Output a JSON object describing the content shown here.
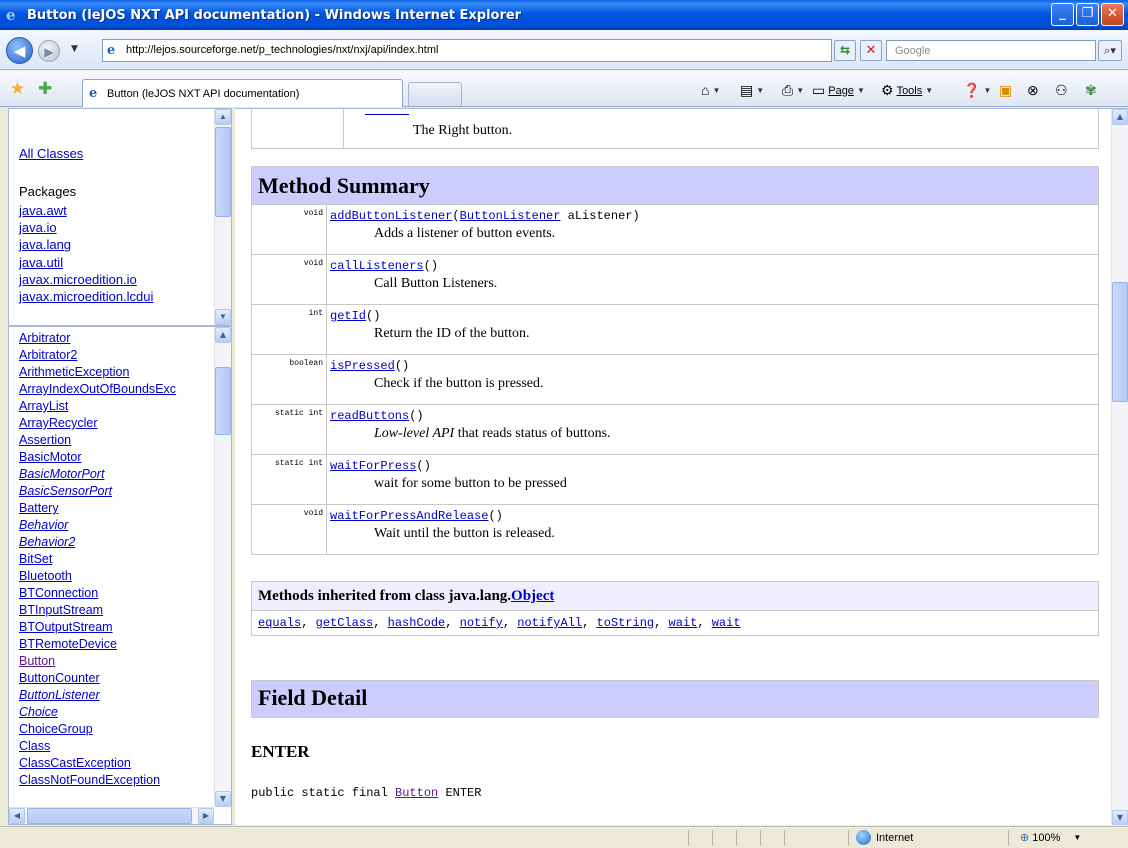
{
  "window": {
    "title": "Button (leJOS NXT API documentation) - Windows Internet Explorer",
    "buttons": [
      "_",
      "❐",
      "✕"
    ]
  },
  "addressbar": {
    "url": "http://lejos.sourceforge.net/p_technologies/nxt/nxj/api/index.html",
    "search_placeholder": "Google"
  },
  "tabbar": {
    "tab_label": "Button (leJOS NXT API documentation)",
    "page_label": "Page",
    "tools_label": "Tools"
  },
  "packages_frame": {
    "all_classes": "All Classes",
    "header": "Packages",
    "items": [
      "java.awt",
      "java.io",
      "java.lang",
      "java.util",
      "javax.microedition.io",
      "javax.microedition.lcdui"
    ]
  },
  "classes_frame": {
    "items": [
      {
        "label": "Arbitrator",
        "italic": false
      },
      {
        "label": "Arbitrator2",
        "italic": false
      },
      {
        "label": "ArithmeticException",
        "italic": false
      },
      {
        "label": "ArrayIndexOutOfBoundsExc",
        "italic": false
      },
      {
        "label": "ArrayList",
        "italic": false
      },
      {
        "label": "ArrayRecycler",
        "italic": false
      },
      {
        "label": "Assertion",
        "italic": false
      },
      {
        "label": "BasicMotor",
        "italic": false
      },
      {
        "label": "BasicMotorPort",
        "italic": true
      },
      {
        "label": "BasicSensorPort",
        "italic": true
      },
      {
        "label": "Battery",
        "italic": false
      },
      {
        "label": "Behavior",
        "italic": true
      },
      {
        "label": "Behavior2",
        "italic": true
      },
      {
        "label": "BitSet",
        "italic": false
      },
      {
        "label": "Bluetooth",
        "italic": false
      },
      {
        "label": "BTConnection",
        "italic": false
      },
      {
        "label": "BTInputStream",
        "italic": false
      },
      {
        "label": "BTOutputStream",
        "italic": false
      },
      {
        "label": "BTRemoteDevice",
        "italic": false
      },
      {
        "label": "Button",
        "italic": false
      },
      {
        "label": "ButtonCounter",
        "italic": false
      },
      {
        "label": "ButtonListener",
        "italic": true
      },
      {
        "label": "Choice",
        "italic": true
      },
      {
        "label": "ChoiceGroup",
        "italic": false
      },
      {
        "label": "Class",
        "italic": false
      },
      {
        "label": "ClassCastException",
        "italic": false
      },
      {
        "label": "ClassNotFoundException",
        "italic": false
      }
    ]
  },
  "content": {
    "top_row_text": "The Right button.",
    "method_summary_title": "Method Summary",
    "methods": [
      {
        "modifier": "void",
        "name": "addButtonListener",
        "params_prefix": "(",
        "param_type": "ButtonListener",
        "params_suffix": " aListener)",
        "desc": "Adds a listener of button events.",
        "desc_em": ""
      },
      {
        "modifier": "void",
        "name": "callListeners",
        "params_prefix": "()",
        "param_type": "",
        "params_suffix": "",
        "desc": "Call Button Listeners.",
        "desc_em": ""
      },
      {
        "modifier": "int",
        "name": "getId",
        "params_prefix": "()",
        "param_type": "",
        "params_suffix": "",
        "desc": "Return the ID of the button.",
        "desc_em": ""
      },
      {
        "modifier": "boolean",
        "name": "isPressed",
        "params_prefix": "()",
        "param_type": "",
        "params_suffix": "",
        "desc": "Check if the button is pressed.",
        "desc_em": ""
      },
      {
        "modifier": "static int",
        "name": "readButtons",
        "params_prefix": "()",
        "param_type": "",
        "params_suffix": "",
        "desc": " that reads status of buttons.",
        "desc_em": "Low-level API"
      },
      {
        "modifier": "static int",
        "name": "waitForPress",
        "params_prefix": "()",
        "param_type": "",
        "params_suffix": "",
        "desc": "wait for some button to be pressed",
        "desc_em": ""
      },
      {
        "modifier": "void",
        "name": "waitForPressAndRelease",
        "params_prefix": "()",
        "param_type": "",
        "params_suffix": "",
        "desc": "Wait until the button is released.",
        "desc_em": ""
      }
    ],
    "inherited_prefix": "Methods inherited from class java.lang.",
    "inherited_class": "Object",
    "inherited_methods": [
      "equals",
      "getClass",
      "hashCode",
      "notify",
      "notifyAll",
      "toString",
      "wait",
      "wait"
    ],
    "field_detail_title": "Field Detail",
    "field_name": "ENTER",
    "field_sig_prefix": "public static final ",
    "field_sig_type": "Button",
    "field_sig_suffix": " ENTER"
  },
  "statusbar": {
    "zone": "Internet",
    "zoom": "100%"
  }
}
